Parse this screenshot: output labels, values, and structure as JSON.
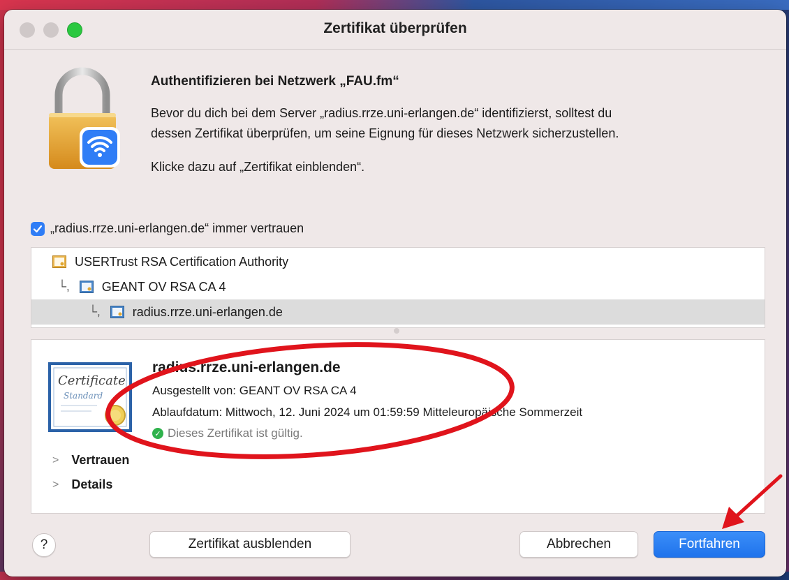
{
  "window": {
    "title": "Zertifikat überprüfen"
  },
  "header": {
    "heading": "Authentifizieren bei Netzwerk „FAU.fm“",
    "description_line1": "Bevor du dich bei dem Server „radius.rrze.uni-erlangen.de“ identifizierst, solltest du",
    "description_line2": "dessen Zertifikat überprüfen, um seine Eignung für dieses Netzwerk sicherzustellen.",
    "hint": "Klicke dazu auf „Zertifikat einblenden“."
  },
  "trust": {
    "checked": true,
    "label": "„radius.rrze.uni-erlangen.de“ immer vertrauen"
  },
  "chain": [
    {
      "label": "USERTrust RSA Certification Authority",
      "level": 0,
      "selected": false
    },
    {
      "label": "GEANT OV RSA CA 4",
      "level": 1,
      "selected": false
    },
    {
      "label": "radius.rrze.uni-erlangen.de",
      "level": 2,
      "selected": true
    }
  ],
  "certificate": {
    "name": "radius.rrze.uni-erlangen.de",
    "issued_by": "Ausgestellt von: GEANT OV RSA CA 4",
    "expiry": "Ablaufdatum: Mittwoch, 12. Juni 2024 um 01:59:59 Mitteleuropäische Sommerzeit",
    "status": "Dieses Zertifikat ist gültig.",
    "image_text": "Certificate Standard"
  },
  "sections": {
    "trust_label": "Vertrauen",
    "details_label": "Details"
  },
  "buttons": {
    "help": "?",
    "hide_certificate": "Zertifikat ausblenden",
    "cancel": "Abbrechen",
    "continue": "Fortfahren"
  },
  "colors": {
    "accent": "#2f7df6",
    "annotation": "#e0141c",
    "valid": "#2fb24c"
  },
  "icons": {
    "lock": "padlock-wifi-icon",
    "cert": "certificate-icon",
    "check": "checkmark-icon"
  }
}
